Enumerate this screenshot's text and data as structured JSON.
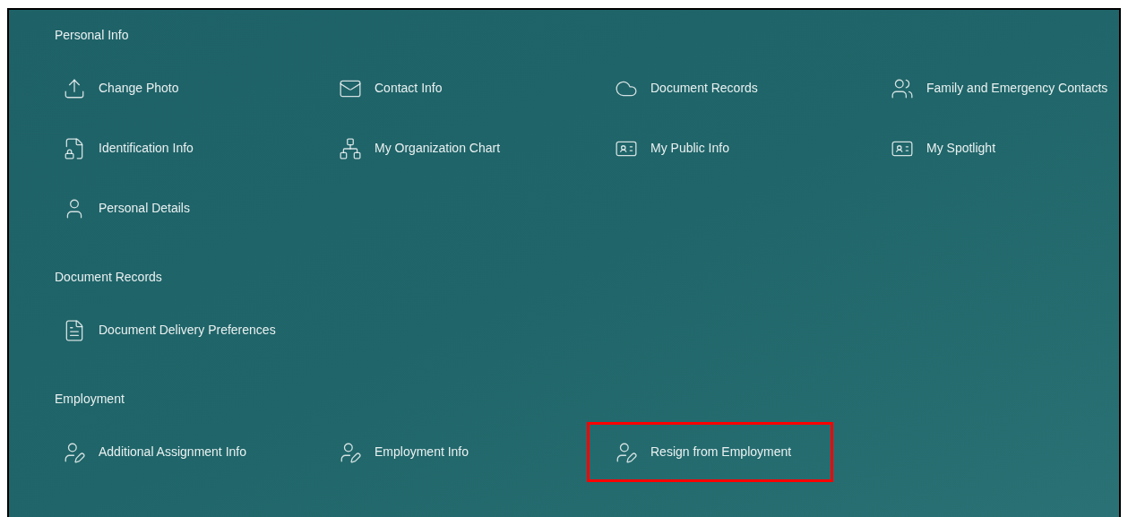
{
  "sections": [
    {
      "title": "Personal Info",
      "items": [
        {
          "label": "Change Photo",
          "kind": "upload",
          "highlighted": false
        },
        {
          "label": "Contact Info",
          "kind": "mail",
          "highlighted": false
        },
        {
          "label": "Document Records",
          "kind": "cloud",
          "highlighted": false
        },
        {
          "label": "Family and Emergency Contacts",
          "kind": "people",
          "highlighted": false
        },
        {
          "label": "Identification Info",
          "kind": "doclock",
          "highlighted": false
        },
        {
          "label": "My Organization Chart",
          "kind": "org",
          "highlighted": false
        },
        {
          "label": "My Public Info",
          "kind": "badge",
          "highlighted": false
        },
        {
          "label": "My Spotlight",
          "kind": "badge",
          "highlighted": false
        },
        {
          "label": "Personal Details",
          "kind": "person",
          "highlighted": false
        }
      ]
    },
    {
      "title": "Document Records",
      "items": [
        {
          "label": "Document Delivery Preferences",
          "kind": "doc",
          "highlighted": false
        }
      ]
    },
    {
      "title": "Employment",
      "items": [
        {
          "label": "Additional Assignment Info",
          "kind": "personpen",
          "highlighted": false
        },
        {
          "label": "Employment Info",
          "kind": "personpen",
          "highlighted": false
        },
        {
          "label": "Resign from Employment",
          "kind": "personpen",
          "highlighted": true
        }
      ]
    }
  ]
}
